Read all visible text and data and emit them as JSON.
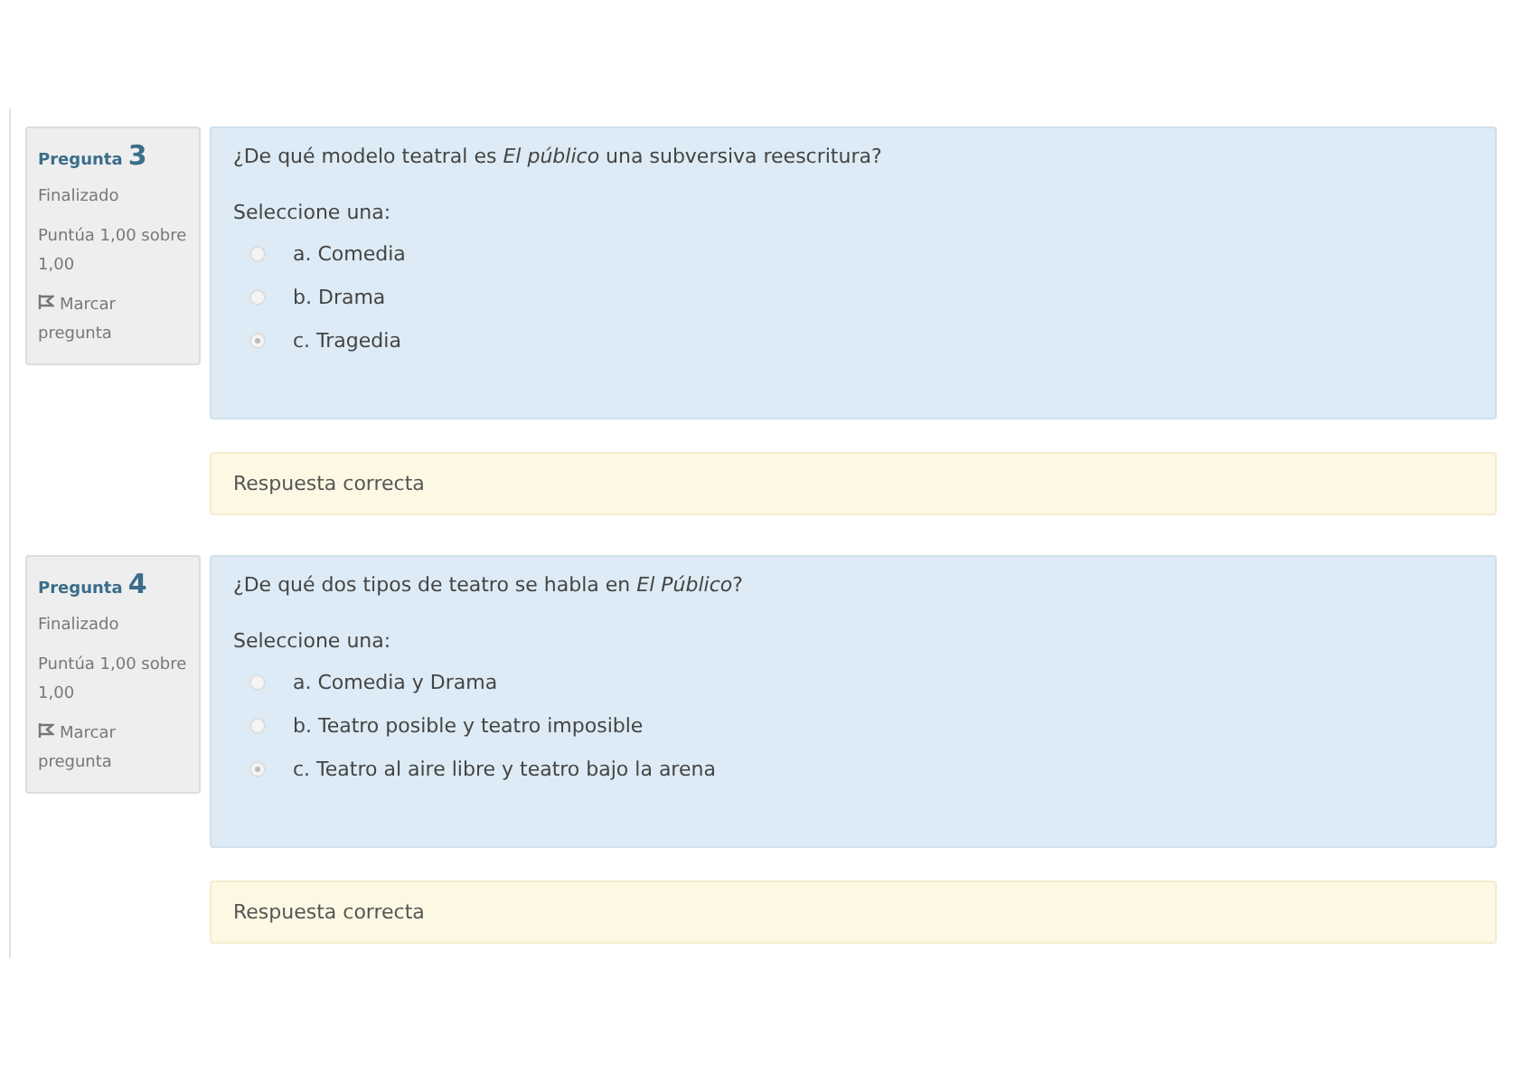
{
  "questions": [
    {
      "label": "Pregunta",
      "number": "3",
      "state": "Finalizado",
      "grade": "Puntúa 1,00 sobre 1,00",
      "flag": "Marcar pregunta",
      "text": "¿De qué modelo teatral es *El público* una subversiva reescritura?",
      "prompt": "Seleccione una:",
      "options": [
        {
          "label": "a. Comedia",
          "selected": false
        },
        {
          "label": "b. Drama",
          "selected": false
        },
        {
          "label": "c. Tragedia",
          "selected": true
        }
      ],
      "feedback": "Respuesta correcta"
    },
    {
      "label": "Pregunta",
      "number": "4",
      "state": "Finalizado",
      "grade": "Puntúa 1,00 sobre 1,00",
      "flag": "Marcar pregunta",
      "text": "¿De qué dos tipos de teatro se habla en *El Público*?",
      "prompt": "Seleccione una:",
      "options": [
        {
          "label": "a. Comedia y Drama",
          "selected": false
        },
        {
          "label": "b. Teatro posible y teatro imposible",
          "selected": false
        },
        {
          "label": "c. Teatro al aire libre y teatro bajo la arena",
          "selected": true
        }
      ],
      "feedback": "Respuesta correcta"
    }
  ]
}
